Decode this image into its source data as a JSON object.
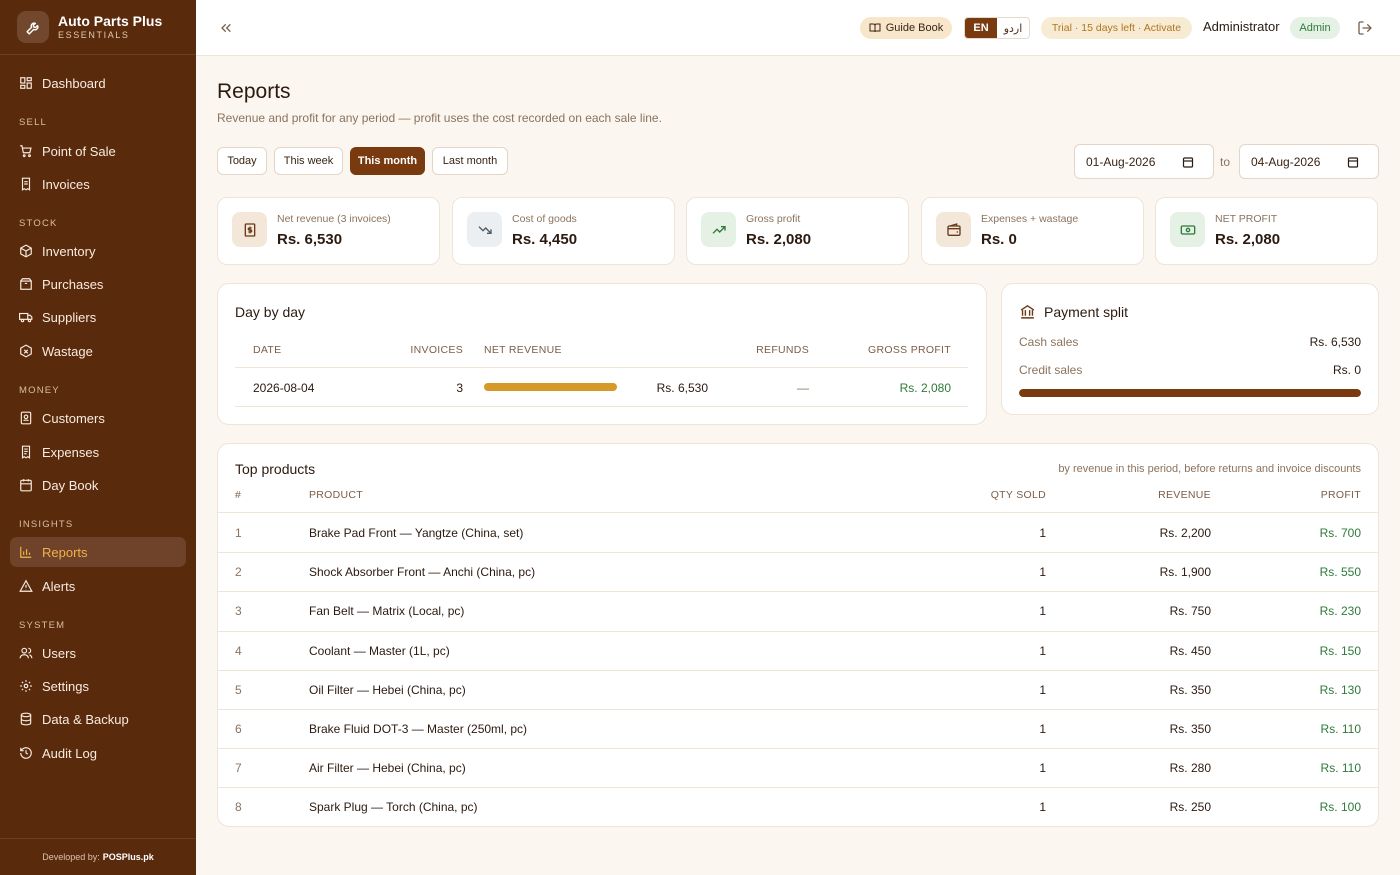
{
  "brand": {
    "name": "Auto Parts Plus",
    "tagline": "ESSENTIALS"
  },
  "nav": {
    "dashboard": "Dashboard",
    "sections": {
      "sell": "SELL",
      "stock": "STOCK",
      "money": "MONEY",
      "insights": "INSIGHTS",
      "system": "SYSTEM"
    },
    "pos": "Point of Sale",
    "invoices": "Invoices",
    "inventory": "Inventory",
    "purchases": "Purchases",
    "suppliers": "Suppliers",
    "wastage": "Wastage",
    "customers": "Customers",
    "expenses": "Expenses",
    "daybook": "Day Book",
    "reports": "Reports",
    "alerts": "Alerts",
    "users": "Users",
    "settings": "Settings",
    "backup": "Data & Backup",
    "audit": "Audit Log"
  },
  "footer": {
    "label": "Developed by:",
    "company": "POSPlus.pk"
  },
  "topbar": {
    "guide": "Guide Book",
    "lang_en": "EN",
    "lang_ur": "اردو",
    "trial": "Trial · 15 days left · Activate",
    "user": "Administrator",
    "role": "Admin"
  },
  "page": {
    "title": "Reports",
    "subtitle": "Revenue and profit for any period — profit uses the cost recorded on each sale line."
  },
  "ranges": {
    "today": "Today",
    "week": "This week",
    "month": "This month",
    "last": "Last month",
    "active": "month"
  },
  "dates": {
    "from": "01-Aug-2026",
    "to_label": "to",
    "to": "04-Aug-2026"
  },
  "stats": {
    "net_revenue": {
      "label": "Net revenue (3 invoices)",
      "value": "Rs. 6,530"
    },
    "cogs": {
      "label": "Cost of goods",
      "value": "Rs. 4,450"
    },
    "gross": {
      "label": "Gross profit",
      "value": "Rs. 2,080"
    },
    "expenses": {
      "label": "Expenses + wastage",
      "value": "Rs. 0"
    },
    "net": {
      "label": "NET PROFIT",
      "value": "Rs. 2,080"
    }
  },
  "daybyday": {
    "title": "Day by day",
    "headers": {
      "date": "DATE",
      "invoices": "INVOICES",
      "revenue": "NET REVENUE",
      "refunds": "REFUNDS",
      "profit": "GROSS PROFIT"
    },
    "row": {
      "date": "2026-08-04",
      "invoices": "3",
      "revenue": "Rs. 6,530",
      "refunds": "—",
      "profit": "Rs. 2,080",
      "revenue_share": 1.0
    }
  },
  "payment": {
    "title": "Payment split",
    "cash_label": "Cash sales",
    "cash_value": "Rs. 6,530",
    "credit_label": "Credit sales",
    "credit_value": "Rs. 0",
    "cash_share": 1.0
  },
  "top": {
    "title": "Top products",
    "note": "by revenue in this period, before returns and invoice discounts",
    "headers": {
      "num": "#",
      "product": "PRODUCT",
      "qty": "QTY SOLD",
      "revenue": "REVENUE",
      "profit": "PROFIT"
    },
    "rows": [
      {
        "num": "1",
        "product": "Brake Pad Front — Yangtze (China, set)",
        "qty": "1",
        "revenue": "Rs. 2,200",
        "profit": "Rs. 700"
      },
      {
        "num": "2",
        "product": "Shock Absorber Front — Anchi (China, pc)",
        "qty": "1",
        "revenue": "Rs. 1,900",
        "profit": "Rs. 550"
      },
      {
        "num": "3",
        "product": "Fan Belt — Matrix (Local, pc)",
        "qty": "1",
        "revenue": "Rs. 750",
        "profit": "Rs. 230"
      },
      {
        "num": "4",
        "product": "Coolant — Master (1L, pc)",
        "qty": "1",
        "revenue": "Rs. 450",
        "profit": "Rs. 150"
      },
      {
        "num": "5",
        "product": "Oil Filter — Hebei (China, pc)",
        "qty": "1",
        "revenue": "Rs. 350",
        "profit": "Rs. 130"
      },
      {
        "num": "6",
        "product": "Brake Fluid DOT-3 — Master (250ml, pc)",
        "qty": "1",
        "revenue": "Rs. 350",
        "profit": "Rs. 110"
      },
      {
        "num": "7",
        "product": "Air Filter — Hebei (China, pc)",
        "qty": "1",
        "revenue": "Rs. 280",
        "profit": "Rs. 110"
      },
      {
        "num": "8",
        "product": "Spark Plug — Torch (China, pc)",
        "qty": "1",
        "revenue": "Rs. 250",
        "profit": "Rs. 100"
      }
    ]
  },
  "colors": {
    "sidebar": "#5a2a0c",
    "accent": "#7a3a10",
    "highlight": "#f0b24a",
    "profit": "#2f7a3a",
    "bar": "#d69a2a"
  }
}
